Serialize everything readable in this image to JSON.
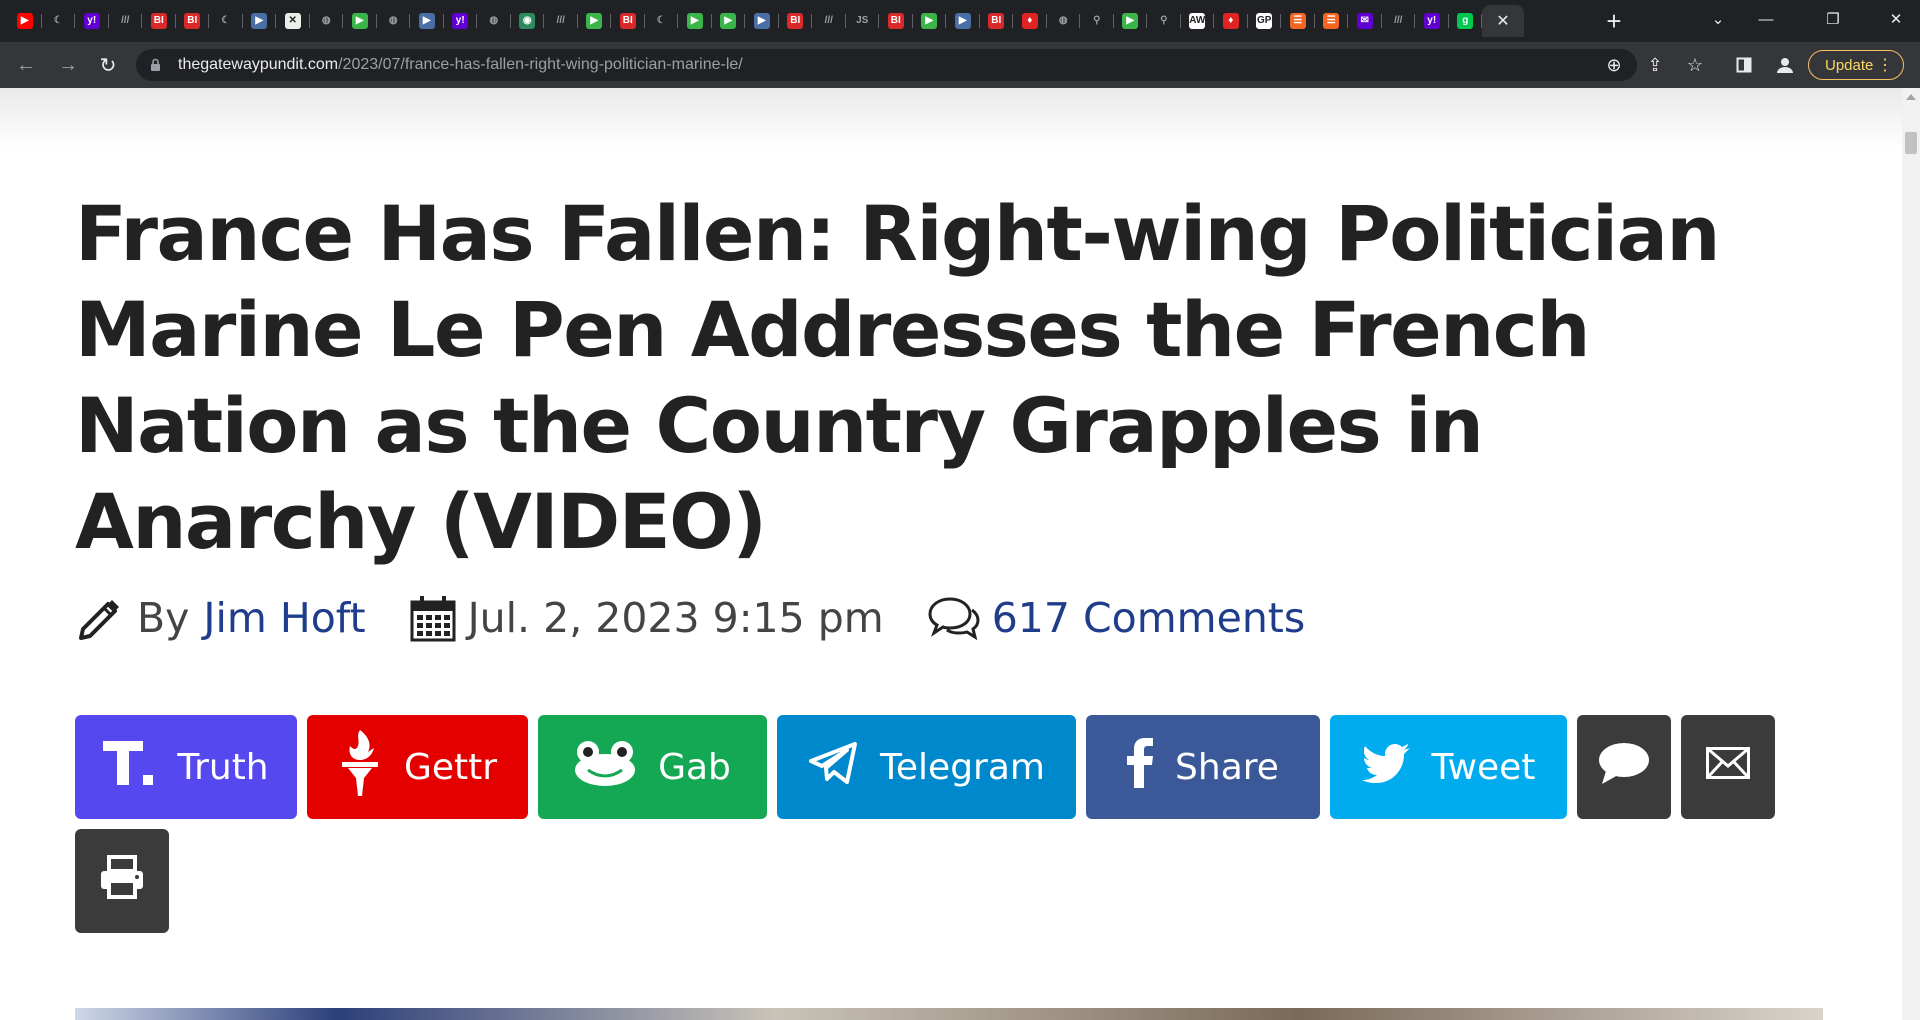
{
  "browser": {
    "tabs": [
      {
        "icon": "youtube-icon",
        "glyph": "▶",
        "bg": "#ff0000"
      },
      {
        "icon": "feather-icon",
        "glyph": "☾",
        "bg": "#202124"
      },
      {
        "icon": "yahoo-icon",
        "glyph": "y!",
        "bg": "#6001d2"
      },
      {
        "icon": "news-icon",
        "glyph": "///",
        "bg": "#202124"
      },
      {
        "icon": "business-insider-icon",
        "glyph": "BI",
        "bg": "#d9292b"
      },
      {
        "icon": "business-insider-icon",
        "glyph": "BI",
        "bg": "#d9292b"
      },
      {
        "icon": "crescent-icon",
        "glyph": "☾",
        "bg": "#202124"
      },
      {
        "icon": "arrow-icon",
        "glyph": "▶",
        "bg": "#4a6fa5"
      },
      {
        "icon": "sheet-icon",
        "glyph": "✕",
        "bg": "#e8f0e8"
      },
      {
        "icon": "globe-icon",
        "glyph": "◍",
        "bg": "#202124"
      },
      {
        "icon": "play-icon",
        "glyph": "▶",
        "bg": "#3bb54a"
      },
      {
        "icon": "globe-icon",
        "glyph": "◍",
        "bg": "#202124"
      },
      {
        "icon": "arrow-icon",
        "glyph": "▶",
        "bg": "#4a6fa5"
      },
      {
        "icon": "yahoo-icon",
        "glyph": "y!",
        "bg": "#6001d2"
      },
      {
        "icon": "globe-icon",
        "glyph": "◍",
        "bg": "#202124"
      },
      {
        "icon": "tree-icon",
        "glyph": "◉",
        "bg": "#2d8a5f"
      },
      {
        "icon": "news-icon",
        "glyph": "///",
        "bg": "#202124"
      },
      {
        "icon": "play-icon",
        "glyph": "▶",
        "bg": "#3bb54a"
      },
      {
        "icon": "business-insider-icon",
        "glyph": "BI",
        "bg": "#d9292b"
      },
      {
        "icon": "crescent-icon",
        "glyph": "☾",
        "bg": "#202124"
      },
      {
        "icon": "play-icon",
        "glyph": "▶",
        "bg": "#3bb54a"
      },
      {
        "icon": "play-icon",
        "glyph": "▶",
        "bg": "#3bb54a"
      },
      {
        "icon": "arrow-icon",
        "glyph": "▶",
        "bg": "#4a6fa5"
      },
      {
        "icon": "business-insider-icon",
        "glyph": "BI",
        "bg": "#d9292b"
      },
      {
        "icon": "news-icon",
        "glyph": "///",
        "bg": "#202124"
      },
      {
        "icon": "js-icon",
        "glyph": "JS",
        "bg": "#202124"
      },
      {
        "icon": "business-insider-icon",
        "glyph": "BI",
        "bg": "#d9292b"
      },
      {
        "icon": "play-icon",
        "glyph": "▶",
        "bg": "#3bb54a"
      },
      {
        "icon": "arrow-icon",
        "glyph": "▶",
        "bg": "#4a6fa5"
      },
      {
        "icon": "business-insider-icon",
        "glyph": "BI",
        "bg": "#d9292b"
      },
      {
        "icon": "torch-icon",
        "glyph": "♦",
        "bg": "#e02424"
      },
      {
        "icon": "globe-icon",
        "glyph": "◍",
        "bg": "#202124"
      },
      {
        "icon": "search-icon",
        "glyph": "⚲",
        "bg": "#202124"
      },
      {
        "icon": "play-icon",
        "glyph": "▶",
        "bg": "#3bb54a"
      },
      {
        "icon": "search-icon",
        "glyph": "⚲",
        "bg": "#202124"
      },
      {
        "icon": "news-icon",
        "glyph": "AW",
        "bg": "#ffffff"
      },
      {
        "icon": "torch-icon",
        "glyph": "♦",
        "bg": "#e02424"
      },
      {
        "icon": "gp-icon",
        "glyph": "GP",
        "bg": "#ffffff"
      },
      {
        "icon": "bookmark-icon",
        "glyph": "☰",
        "bg": "#f26522"
      },
      {
        "icon": "bookmark-icon",
        "glyph": "☰",
        "bg": "#f26522"
      },
      {
        "icon": "mail-icon",
        "glyph": "✉",
        "bg": "#6001d2"
      },
      {
        "icon": "news-icon",
        "glyph": "///",
        "bg": "#202124"
      },
      {
        "icon": "yahoo-icon",
        "glyph": "y!",
        "bg": "#6001d2"
      },
      {
        "icon": "g-icon",
        "glyph": "g",
        "bg": "#00c850"
      }
    ],
    "active_tab_close": "✕",
    "new_tab": "+",
    "url_host": "thegatewaypundit.com",
    "url_path": "/2023/07/france-has-fallen-right-wing-politician-marine-le/",
    "update_label": "Update"
  },
  "article": {
    "headline": "France Has Fallen: Right-wing Politician Marine Le Pen Addresses the French Nation as the Country Grapples in Anarchy (VIDEO)",
    "by_label": "By",
    "author": "Jim Hoft",
    "date": "Jul. 2, 2023 9:15 pm",
    "comments": "617 Comments"
  },
  "share_buttons": [
    {
      "label": "Truth",
      "color": "#5448ee",
      "icon": "truth-social-icon"
    },
    {
      "label": "Gettr",
      "color": "#e50000",
      "icon": "gettr-icon"
    },
    {
      "label": "Gab",
      "color": "#15a854",
      "icon": "gab-frog-icon"
    },
    {
      "label": "Telegram",
      "color": "#0088cc",
      "icon": "telegram-icon"
    },
    {
      "label": "Share",
      "color": "#3b5998",
      "icon": "facebook-icon"
    },
    {
      "label": "Tweet",
      "color": "#00acee",
      "icon": "twitter-icon"
    },
    {
      "label": "",
      "color": "#3b3b3b",
      "icon": "sms-icon"
    },
    {
      "label": "",
      "color": "#3b3b3b",
      "icon": "email-icon"
    },
    {
      "label": "",
      "color": "#3b3b3b",
      "icon": "print-icon"
    }
  ]
}
